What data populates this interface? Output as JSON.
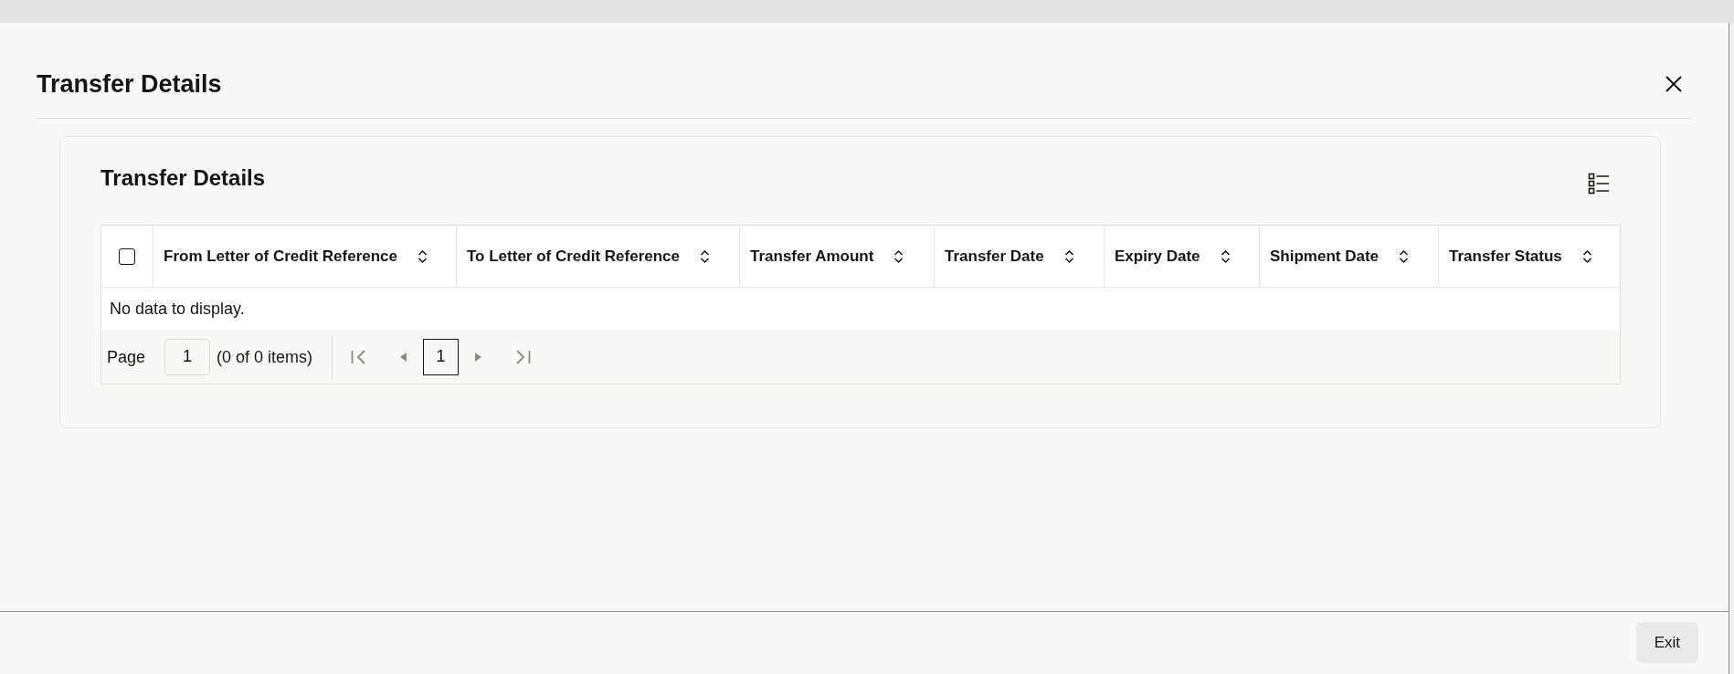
{
  "window": {
    "title": "Transfer Details"
  },
  "panel": {
    "title": "Transfer Details"
  },
  "table": {
    "select_all": {
      "checked": false
    },
    "columns": [
      "From Letter of Credit Reference",
      "To Letter of Credit Reference",
      "Transfer Amount",
      "Transfer Date",
      "Expiry Date",
      "Shipment Date",
      "Transfer Status"
    ],
    "empty_message": "No data to display."
  },
  "pagination": {
    "page_label": "Page",
    "page_value": "1",
    "item_count": "(0 of 0 items)",
    "nav": [
      {
        "kind": "first",
        "disabled": true
      },
      {
        "kind": "previous",
        "disabled": true
      },
      {
        "kind": "next",
        "disabled": true
      },
      {
        "kind": "last",
        "disabled": true
      }
    ],
    "pages": [
      {
        "label": "1",
        "selected": true
      }
    ]
  },
  "footer": {
    "buttons": [
      "Exit"
    ]
  }
}
